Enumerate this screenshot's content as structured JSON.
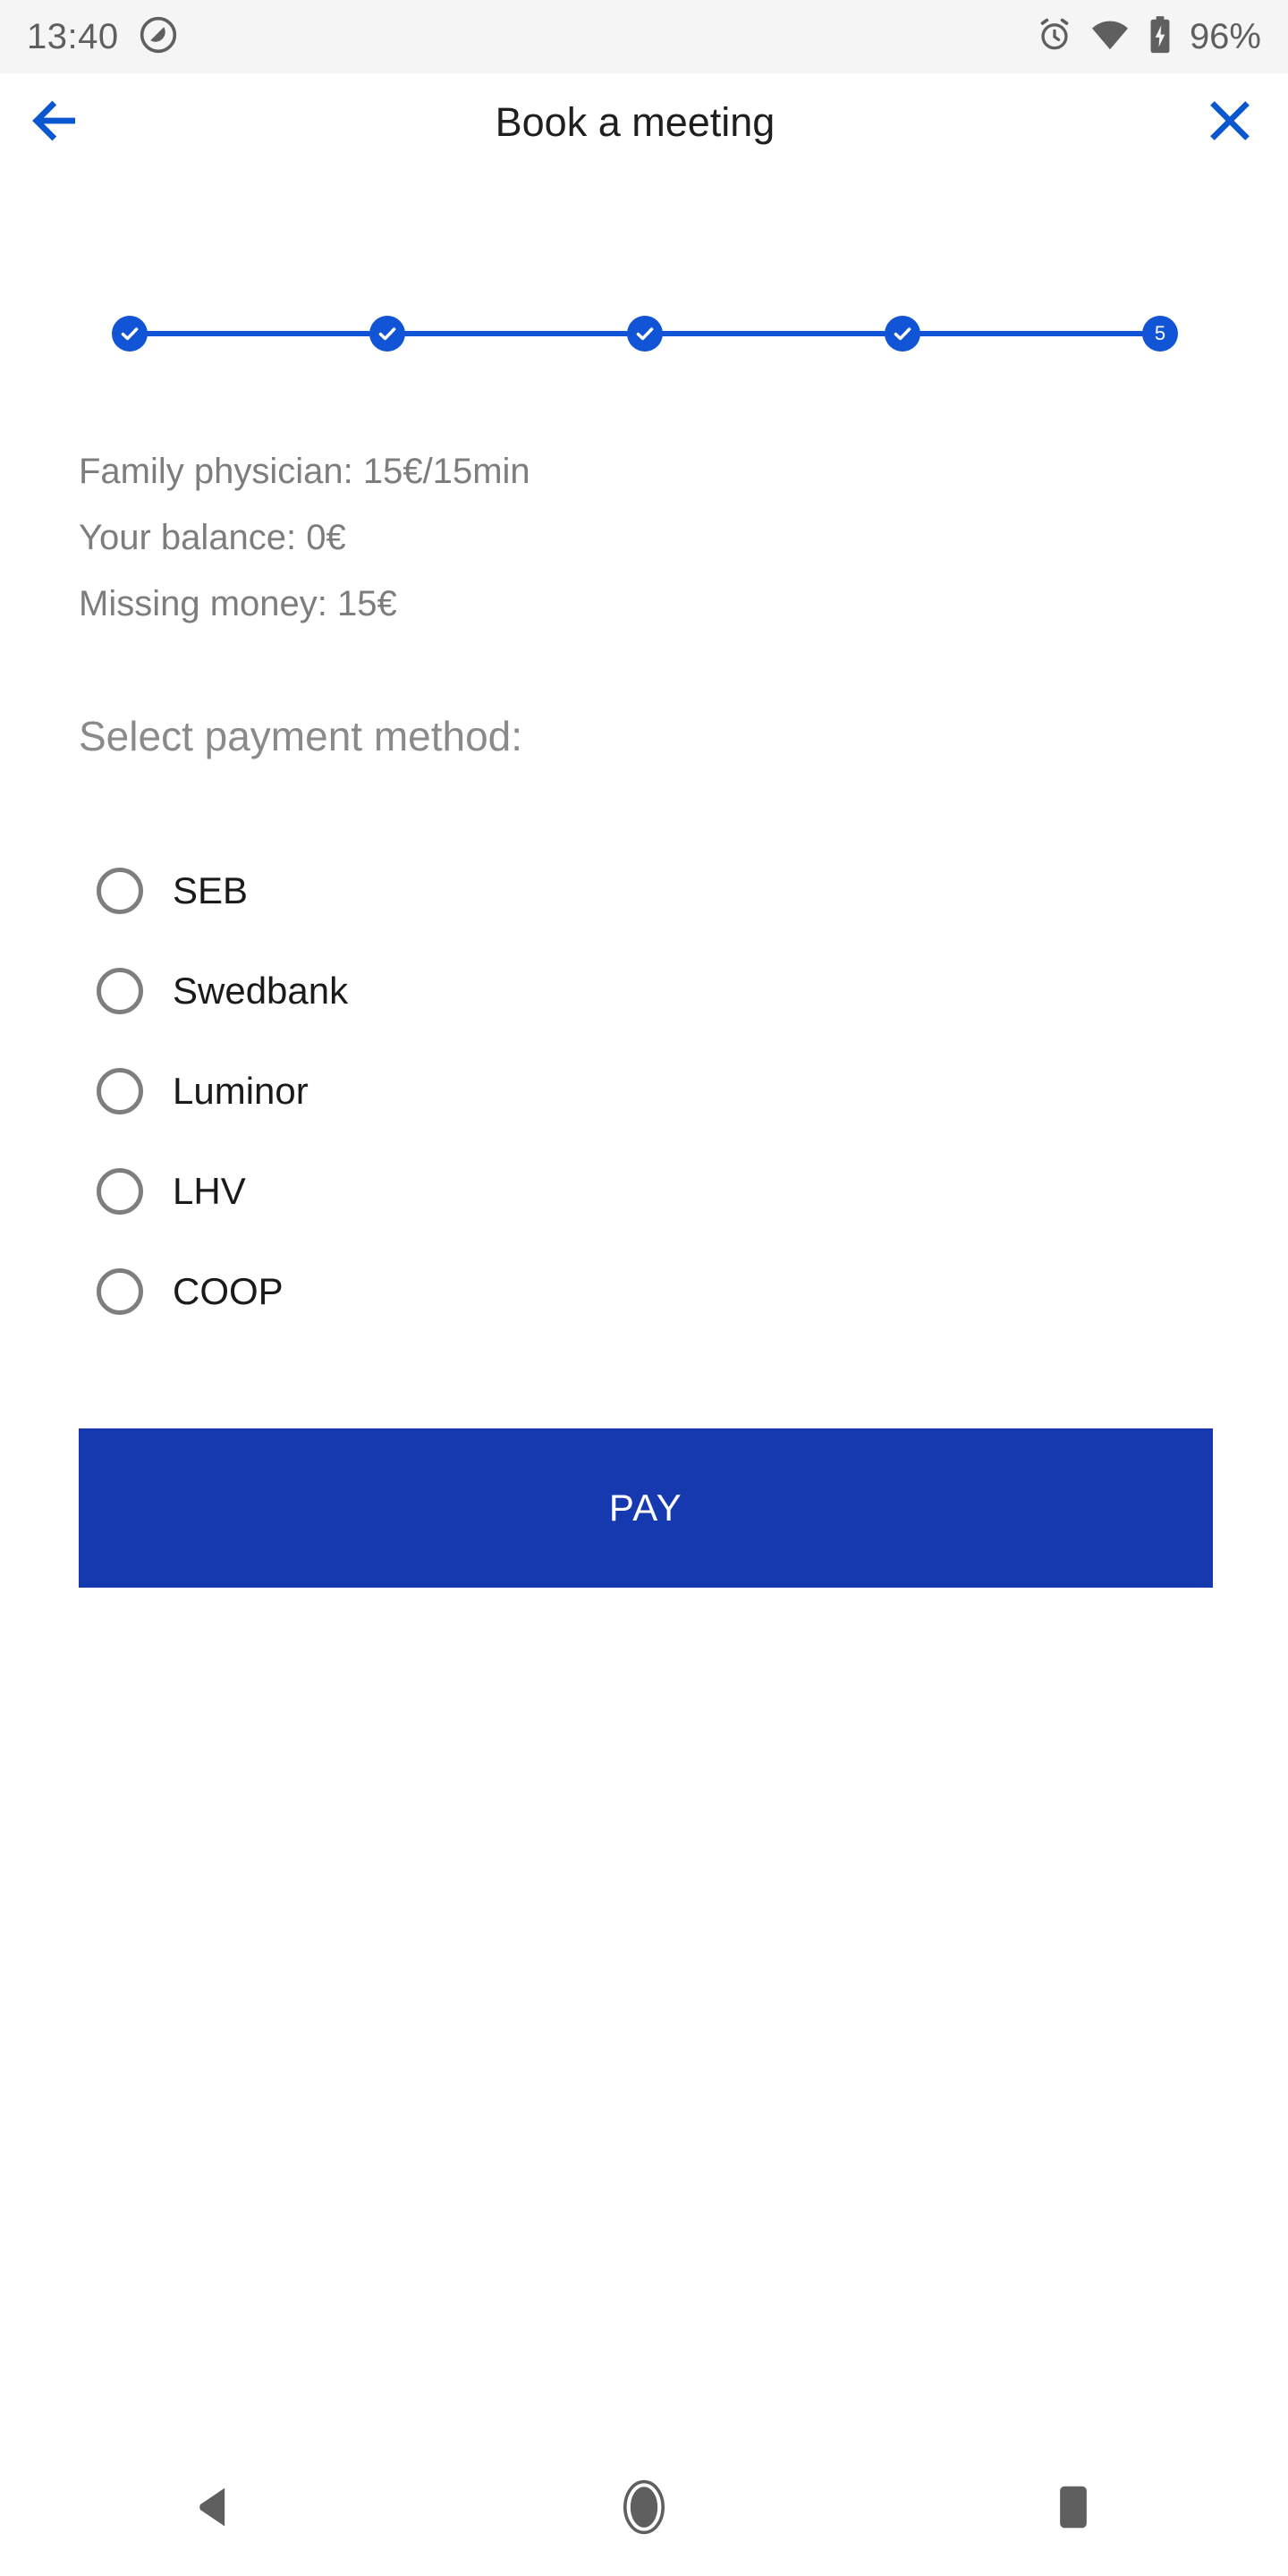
{
  "statusbar": {
    "time": "13:40",
    "dnd_icon": "do-not-disturb-icon",
    "alarm_icon": "alarm-icon",
    "wifi_icon": "wifi-icon",
    "battery_icon": "battery-charging-icon",
    "battery_text": "96%",
    "background": "#f5f5f5",
    "text_color": "#5f5f5f"
  },
  "header": {
    "back_icon": "arrow-left-icon",
    "title": "Book a meeting",
    "close_icon": "close-icon",
    "accent": "#0b57d0"
  },
  "stepper": {
    "accent": "#1155d6",
    "current_step": 5,
    "total_steps": 5,
    "steps": [
      {
        "label": "1",
        "state": "completed",
        "glyph": "check-icon"
      },
      {
        "label": "2",
        "state": "completed",
        "glyph": "check-icon"
      },
      {
        "label": "3",
        "state": "completed",
        "glyph": "check-icon"
      },
      {
        "label": "4",
        "state": "completed",
        "glyph": "check-icon"
      },
      {
        "label": "5",
        "state": "current",
        "glyph": "5"
      }
    ]
  },
  "summary": {
    "lines": [
      "Family physician: 15€/15min",
      "Your balance: 0€",
      "Missing money: 15€"
    ],
    "text_color": "#7d7d7d"
  },
  "payment": {
    "section_label": "Select payment method:",
    "selected": null,
    "options": [
      {
        "label": "SEB",
        "selected": false
      },
      {
        "label": "Swedbank",
        "selected": false
      },
      {
        "label": "Luminor",
        "selected": false
      },
      {
        "label": "LHV",
        "selected": false
      },
      {
        "label": "COOP",
        "selected": false
      }
    ]
  },
  "pay_button": {
    "label": "PAY",
    "background": "#1639b0",
    "text_color": "#ffffff"
  },
  "navbar": {
    "back_icon": "nav-back-triangle-icon",
    "home_icon": "nav-home-circle-icon",
    "recents_icon": "nav-recents-square-icon",
    "color": "#5f5f5f"
  }
}
